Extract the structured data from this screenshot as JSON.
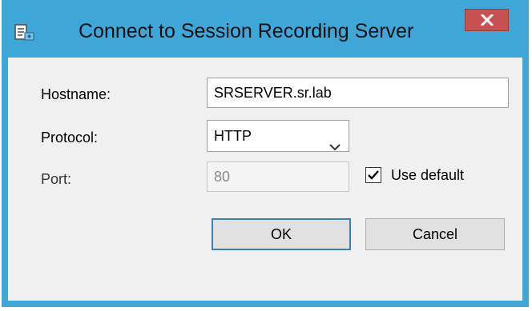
{
  "dialog": {
    "title": "Connect to Session Recording Server",
    "icon": "session-recording-icon",
    "close_icon": "close-icon"
  },
  "form": {
    "hostname_label": "Hostname:",
    "hostname_value": "SRSERVER.sr.lab",
    "protocol_label": "Protocol:",
    "protocol_value": "HTTP",
    "port_label": "Port:",
    "port_value": "80",
    "use_default_label": "Use default",
    "use_default_checked": true
  },
  "buttons": {
    "ok": "OK",
    "cancel": "Cancel"
  },
  "colors": {
    "frame": "#3fa6d8",
    "close_button": "#c75050",
    "client_bg": "#f0f0f0",
    "default_button_border": "#3c7fb1"
  }
}
